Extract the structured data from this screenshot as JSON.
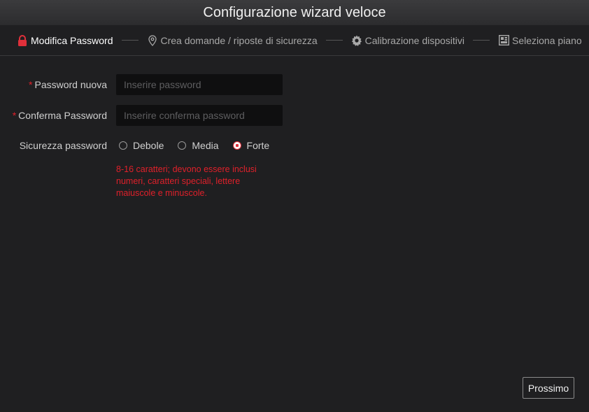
{
  "window": {
    "title": "Configurazione wizard veloce"
  },
  "steps": [
    {
      "label": "Modifica Password",
      "icon": "lock-icon",
      "active": true
    },
    {
      "label": "Crea domande / riposte di sicurezza",
      "icon": "location-pin-icon",
      "active": false
    },
    {
      "label": "Calibrazione dispositivi",
      "icon": "gear-icon",
      "active": false
    },
    {
      "label": "Seleziona piano",
      "icon": "layout-grid-icon",
      "active": false
    }
  ],
  "form": {
    "new_password": {
      "label": "Password nuova",
      "placeholder": "Inserire password",
      "value": ""
    },
    "confirm_password": {
      "label": "Conferma Password",
      "placeholder": "Inserire conferma password",
      "value": ""
    },
    "strength": {
      "label": "Sicurezza password",
      "options": [
        "Debole",
        "Media",
        "Forte"
      ],
      "selected": "Forte"
    },
    "hint": "8-16 caratteri; devono essere inclusi numeri, caratteri speciali, lettere maiuscole e minuscole.",
    "required_mark": "*"
  },
  "footer": {
    "next_label": "Prossimo"
  },
  "colors": {
    "accent": "#e0202a",
    "background": "#1f1f21",
    "input_bg": "#0f0f10"
  }
}
